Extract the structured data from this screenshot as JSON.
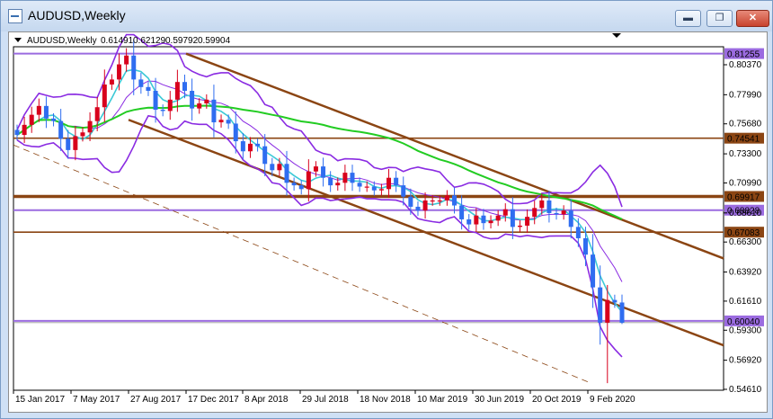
{
  "window": {
    "title": "AUDUSD,Weekly",
    "minimize_label": "▬",
    "restore_label": "❐",
    "close_label": "✕"
  },
  "info": {
    "symbol": "AUDUSD,Weekly",
    "open": "0.61491",
    "high": "0.62129",
    "low": "0.59792",
    "close": "0.59904"
  },
  "colors": {
    "bull": "#d8001c",
    "bear": "#2f6df0",
    "bollinger": "#8a2be2",
    "ma_fast": "#3cc9d6",
    "ma_slow": "#22cc22",
    "channel": "#8b4513",
    "hline_purple": "#9b6be0",
    "hline_brown": "#8b4513"
  },
  "chart_data": {
    "type": "candlestick",
    "symbol": "AUDUSD",
    "timeframe": "Weekly",
    "y_ticks": [
      0.8037,
      0.7799,
      0.7568,
      0.733,
      0.7099,
      0.6861,
      0.663,
      0.6392,
      0.6161,
      0.593,
      0.5692,
      0.5461
    ],
    "y_tick_labels": [
      "0.80370",
      "0.77990",
      "0.75680",
      "0.73300",
      "0.70990",
      "0.68610",
      "0.66300",
      "0.63920",
      "0.61610",
      "0.59300",
      "0.56920",
      "0.54610"
    ],
    "x_tick_labels": [
      "15 Jan 2017",
      "7 May 2017",
      "27 Aug 2017",
      "17 Dec 2017",
      "8 Apr 2018",
      "29 Jul 2018",
      "18 Nov 2018",
      "10 Mar 2019",
      "30 Jun 2019",
      "20 Oct 2019",
      "9 Feb 2020"
    ],
    "ylim": [
      0.54,
      0.82
    ],
    "horizontal_levels": [
      {
        "value": 0.81255,
        "label": "0.81255",
        "color": "purple"
      },
      {
        "value": 0.74541,
        "label": "0.74541",
        "color": "brown"
      },
      {
        "value": 0.69917,
        "label": "0.69917",
        "color": "brown"
      },
      {
        "value": 0.68828,
        "label": "0.68828",
        "color": "purple"
      },
      {
        "value": 0.67083,
        "label": "0.67083",
        "color": "brown"
      },
      {
        "value": 0.6004,
        "label": "0.60040",
        "color": "purple"
      }
    ],
    "trend_lines": [
      {
        "from": [
          "17 Dec 2017",
          0.8125
        ],
        "to": [
          "end",
          0.65
        ]
      },
      {
        "from": [
          "27 Aug 2017",
          0.76
        ],
        "to": [
          "end",
          0.581
        ]
      },
      {
        "from": [
          "15 Jan 2017",
          0.74
        ],
        "to": [
          "9 Feb 2020",
          0.552
        ],
        "style": "dashed"
      }
    ],
    "ohlc_close_series": [
      0.748,
      0.756,
      0.764,
      0.771,
      0.761,
      0.759,
      0.745,
      0.736,
      0.747,
      0.75,
      0.759,
      0.77,
      0.788,
      0.792,
      0.804,
      0.811,
      0.792,
      0.786,
      0.783,
      0.768,
      0.767,
      0.776,
      0.79,
      0.783,
      0.769,
      0.773,
      0.776,
      0.758,
      0.76,
      0.757,
      0.743,
      0.735,
      0.741,
      0.739,
      0.725,
      0.72,
      0.725,
      0.71,
      0.708,
      0.705,
      0.719,
      0.723,
      0.714,
      0.708,
      0.71,
      0.718,
      0.71,
      0.707,
      0.707,
      0.704,
      0.705,
      0.714,
      0.708,
      0.699,
      0.691,
      0.688,
      0.696,
      0.696,
      0.696,
      0.7,
      0.692,
      0.681,
      0.677,
      0.684,
      0.678,
      0.68,
      0.684,
      0.689,
      0.675,
      0.676,
      0.683,
      0.69,
      0.696,
      0.686,
      0.685,
      0.688,
      0.675,
      0.666,
      0.653,
      0.627,
      0.599,
      0.617,
      0.615,
      0.599
    ],
    "indicators": [
      "Bollinger Bands",
      "Moving Average (fast)",
      "Moving Average (200)"
    ],
    "last_close": 0.59904
  }
}
